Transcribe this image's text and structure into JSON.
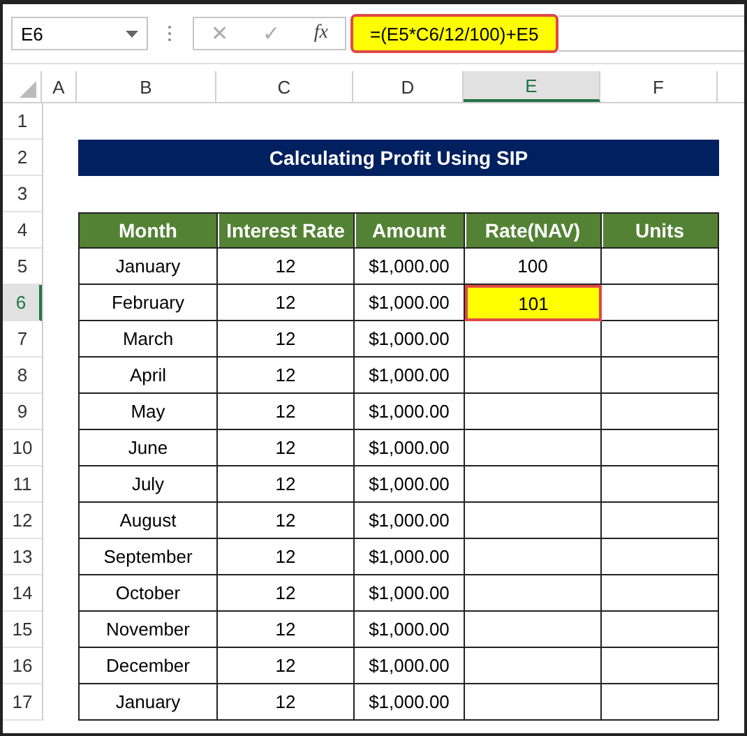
{
  "name_box": {
    "value": "E6"
  },
  "formula_bar": {
    "cancel": "✕",
    "enter": "✓",
    "fx": "fx",
    "formula": "=(E5*C6/12/100)+E5",
    "highlighted": true
  },
  "columns": [
    {
      "label": "A",
      "selected": false
    },
    {
      "label": "B",
      "selected": false
    },
    {
      "label": "C",
      "selected": false
    },
    {
      "label": "D",
      "selected": false
    },
    {
      "label": "E",
      "selected": true
    },
    {
      "label": "F",
      "selected": false
    }
  ],
  "row_numbers": [
    {
      "label": "1",
      "selected": false
    },
    {
      "label": "2",
      "selected": false
    },
    {
      "label": "3",
      "selected": false
    },
    {
      "label": "4",
      "selected": false
    },
    {
      "label": "5",
      "selected": false
    },
    {
      "label": "6",
      "selected": true
    },
    {
      "label": "7",
      "selected": false
    },
    {
      "label": "8",
      "selected": false
    },
    {
      "label": "9",
      "selected": false
    },
    {
      "label": "10",
      "selected": false
    },
    {
      "label": "11",
      "selected": false
    },
    {
      "label": "12",
      "selected": false
    },
    {
      "label": "13",
      "selected": false
    },
    {
      "label": "14",
      "selected": false
    },
    {
      "label": "15",
      "selected": false
    },
    {
      "label": "16",
      "selected": false
    },
    {
      "label": "17",
      "selected": false
    }
  ],
  "title": "Calculating Profit Using SIP",
  "table": {
    "headers": [
      "Month",
      "Interest Rate",
      "Amount",
      "Rate(NAV)",
      "Units"
    ],
    "rows": [
      {
        "cells": [
          {
            "text": "January",
            "highlighted": false
          },
          {
            "text": "12",
            "highlighted": false
          },
          {
            "text": "$1,000.00",
            "highlighted": false
          },
          {
            "text": "100",
            "highlighted": false
          },
          {
            "text": "",
            "highlighted": false
          }
        ]
      },
      {
        "cells": [
          {
            "text": "February",
            "highlighted": false
          },
          {
            "text": "12",
            "highlighted": false
          },
          {
            "text": "$1,000.00",
            "highlighted": false
          },
          {
            "text": "101",
            "highlighted": true
          },
          {
            "text": "",
            "highlighted": false
          }
        ]
      },
      {
        "cells": [
          {
            "text": "March",
            "highlighted": false
          },
          {
            "text": "12",
            "highlighted": false
          },
          {
            "text": "$1,000.00",
            "highlighted": false
          },
          {
            "text": "",
            "highlighted": false
          },
          {
            "text": "",
            "highlighted": false
          }
        ]
      },
      {
        "cells": [
          {
            "text": "April",
            "highlighted": false
          },
          {
            "text": "12",
            "highlighted": false
          },
          {
            "text": "$1,000.00",
            "highlighted": false
          },
          {
            "text": "",
            "highlighted": false
          },
          {
            "text": "",
            "highlighted": false
          }
        ]
      },
      {
        "cells": [
          {
            "text": "May",
            "highlighted": false
          },
          {
            "text": "12",
            "highlighted": false
          },
          {
            "text": "$1,000.00",
            "highlighted": false
          },
          {
            "text": "",
            "highlighted": false
          },
          {
            "text": "",
            "highlighted": false
          }
        ]
      },
      {
        "cells": [
          {
            "text": "June",
            "highlighted": false
          },
          {
            "text": "12",
            "highlighted": false
          },
          {
            "text": "$1,000.00",
            "highlighted": false
          },
          {
            "text": "",
            "highlighted": false
          },
          {
            "text": "",
            "highlighted": false
          }
        ]
      },
      {
        "cells": [
          {
            "text": "July",
            "highlighted": false
          },
          {
            "text": "12",
            "highlighted": false
          },
          {
            "text": "$1,000.00",
            "highlighted": false
          },
          {
            "text": "",
            "highlighted": false
          },
          {
            "text": "",
            "highlighted": false
          }
        ]
      },
      {
        "cells": [
          {
            "text": "August",
            "highlighted": false
          },
          {
            "text": "12",
            "highlighted": false
          },
          {
            "text": "$1,000.00",
            "highlighted": false
          },
          {
            "text": "",
            "highlighted": false
          },
          {
            "text": "",
            "highlighted": false
          }
        ]
      },
      {
        "cells": [
          {
            "text": "September",
            "highlighted": false
          },
          {
            "text": "12",
            "highlighted": false
          },
          {
            "text": "$1,000.00",
            "highlighted": false
          },
          {
            "text": "",
            "highlighted": false
          },
          {
            "text": "",
            "highlighted": false
          }
        ]
      },
      {
        "cells": [
          {
            "text": "October",
            "highlighted": false
          },
          {
            "text": "12",
            "highlighted": false
          },
          {
            "text": "$1,000.00",
            "highlighted": false
          },
          {
            "text": "",
            "highlighted": false
          },
          {
            "text": "",
            "highlighted": false
          }
        ]
      },
      {
        "cells": [
          {
            "text": "November",
            "highlighted": false
          },
          {
            "text": "12",
            "highlighted": false
          },
          {
            "text": "$1,000.00",
            "highlighted": false
          },
          {
            "text": "",
            "highlighted": false
          },
          {
            "text": "",
            "highlighted": false
          }
        ]
      },
      {
        "cells": [
          {
            "text": "December",
            "highlighted": false
          },
          {
            "text": "12",
            "highlighted": false
          },
          {
            "text": "$1,000.00",
            "highlighted": false
          },
          {
            "text": "",
            "highlighted": false
          },
          {
            "text": "",
            "highlighted": false
          }
        ]
      },
      {
        "cells": [
          {
            "text": "January",
            "highlighted": false
          },
          {
            "text": "12",
            "highlighted": false
          },
          {
            "text": "$1,000.00",
            "highlighted": false
          },
          {
            "text": "",
            "highlighted": false
          },
          {
            "text": "",
            "highlighted": false
          }
        ]
      }
    ]
  }
}
